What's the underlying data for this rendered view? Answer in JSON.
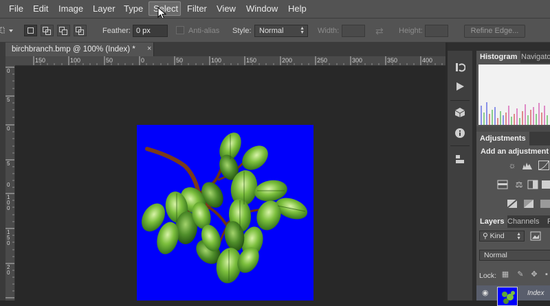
{
  "menu": {
    "items": [
      "File",
      "Edit",
      "Image",
      "Layer",
      "Type",
      "Select",
      "Filter",
      "View",
      "Window",
      "Help"
    ],
    "highlighted": "Select"
  },
  "options_bar": {
    "feather_label": "Feather:",
    "feather_value": "0 px",
    "antialias_label": "Anti-alias",
    "style_label": "Style:",
    "style_value": "Normal",
    "width_label": "Width:",
    "height_label": "Height:",
    "refine_edge_label": "Refine Edge..."
  },
  "document": {
    "tab_title": "birchbranch.bmp @ 100% (Index) *",
    "close_glyph": "×",
    "ruler_top": [
      "150",
      "100",
      "50",
      "0",
      "50",
      "100",
      "150",
      "200",
      "250",
      "300",
      "350",
      "400"
    ],
    "ruler_left": [
      "0",
      "5",
      "0",
      "5",
      "0",
      "1 0 0",
      "1 5 0",
      "2 0"
    ],
    "image_background_color": "#0000fb"
  },
  "panels": {
    "histogram_tabs": [
      "Histogram",
      "Navigator"
    ],
    "adjustments_tab": "Adjustments",
    "adjustments_title": "Add an adjustment",
    "layers_tabs": [
      "Layers",
      "Channels",
      "P"
    ],
    "kind_label": "Kind",
    "blend_mode": "Normal",
    "lock_label": "Lock:",
    "layer_name": "Index"
  },
  "colors": {
    "chrome": "#535353",
    "canvas_bg": "#282828",
    "image_blue": "#0000fb"
  }
}
